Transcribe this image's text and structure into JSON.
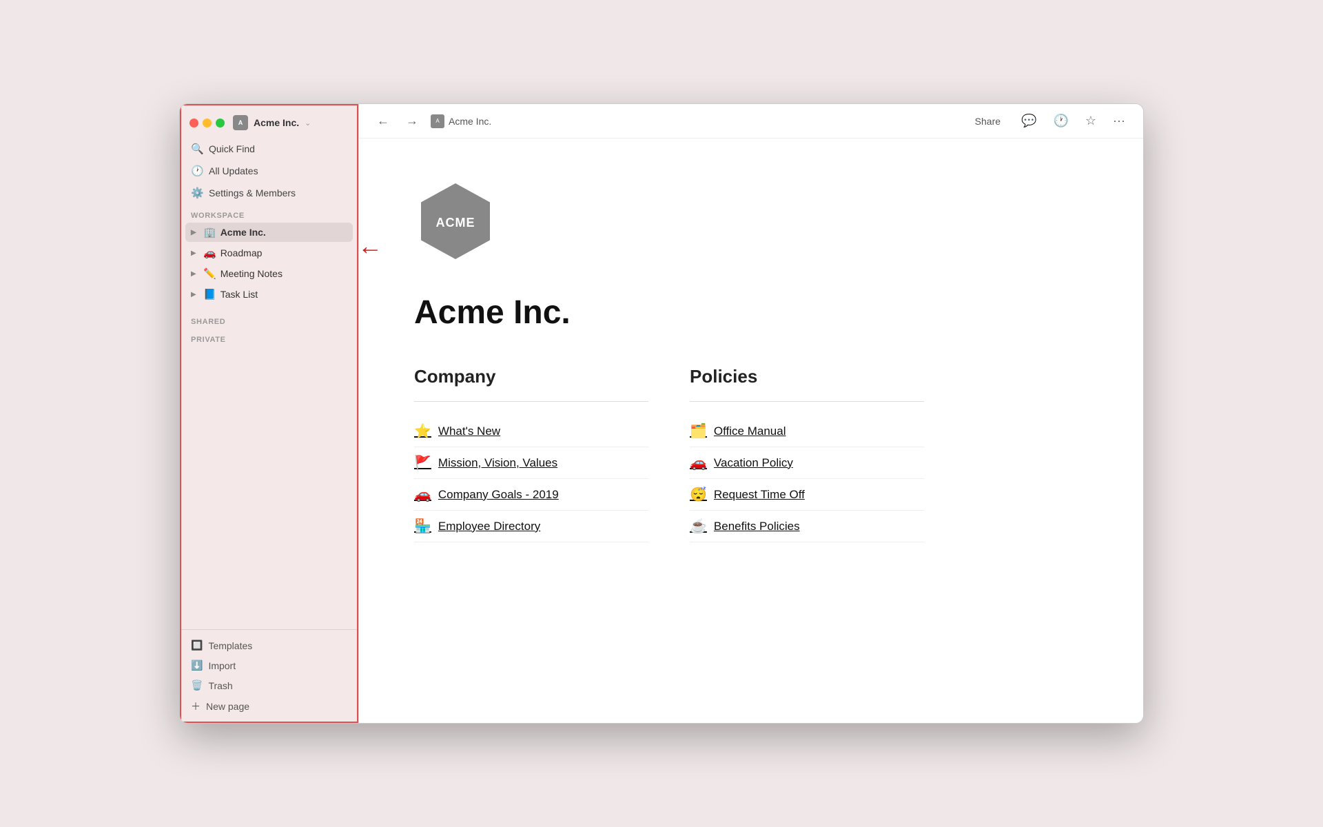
{
  "window": {
    "title": "Acme Inc."
  },
  "sidebar": {
    "workspace": {
      "name": "Acme Inc.",
      "icon_label": "A"
    },
    "nav_items": [
      {
        "id": "quick-find",
        "icon": "🔍",
        "label": "Quick Find"
      },
      {
        "id": "all-updates",
        "icon": "🕐",
        "label": "All Updates"
      },
      {
        "id": "settings",
        "icon": "⚙️",
        "label": "Settings & Members"
      }
    ],
    "workspace_section_label": "WORKSPACE",
    "workspace_items": [
      {
        "id": "acme-inc",
        "emoji": "🏢",
        "label": "Acme Inc.",
        "active": true
      },
      {
        "id": "roadmap",
        "emoji": "🚗",
        "label": "Roadmap"
      },
      {
        "id": "meeting-notes",
        "emoji": "✏️",
        "label": "Meeting Notes"
      },
      {
        "id": "task-list",
        "emoji": "📘",
        "label": "Task List"
      }
    ],
    "shared_label": "SHARED",
    "private_label": "PRIVATE",
    "bottom_items": [
      {
        "id": "templates",
        "icon": "🔲",
        "label": "Templates"
      },
      {
        "id": "import",
        "icon": "⬇️",
        "label": "Import"
      },
      {
        "id": "trash",
        "icon": "🗑️",
        "label": "Trash"
      }
    ],
    "new_page_label": "New page"
  },
  "topbar": {
    "breadcrumb_icon": "A",
    "breadcrumb_label": "Acme Inc.",
    "share_label": "Share",
    "icons": {
      "comment": "💬",
      "history": "🕐",
      "favorite": "☆",
      "more": "···"
    }
  },
  "page": {
    "title": "Acme Inc.",
    "logo_text": "ACME",
    "company_section": {
      "title": "Company",
      "links": [
        {
          "emoji": "⭐",
          "label": "What's New"
        },
        {
          "emoji": "🚩",
          "label": "Mission, Vision, Values"
        },
        {
          "emoji": "🚗",
          "label": "Company Goals - 2019"
        },
        {
          "emoji": "🏪",
          "label": "Employee Directory"
        }
      ]
    },
    "policies_section": {
      "title": "Policies",
      "links": [
        {
          "emoji": "🗂️",
          "label": "Office Manual"
        },
        {
          "emoji": "🚗",
          "label": "Vacation Policy"
        },
        {
          "emoji": "😴",
          "label": "Request Time Off"
        },
        {
          "emoji": "☕",
          "label": "Benefits Policies"
        }
      ]
    }
  }
}
